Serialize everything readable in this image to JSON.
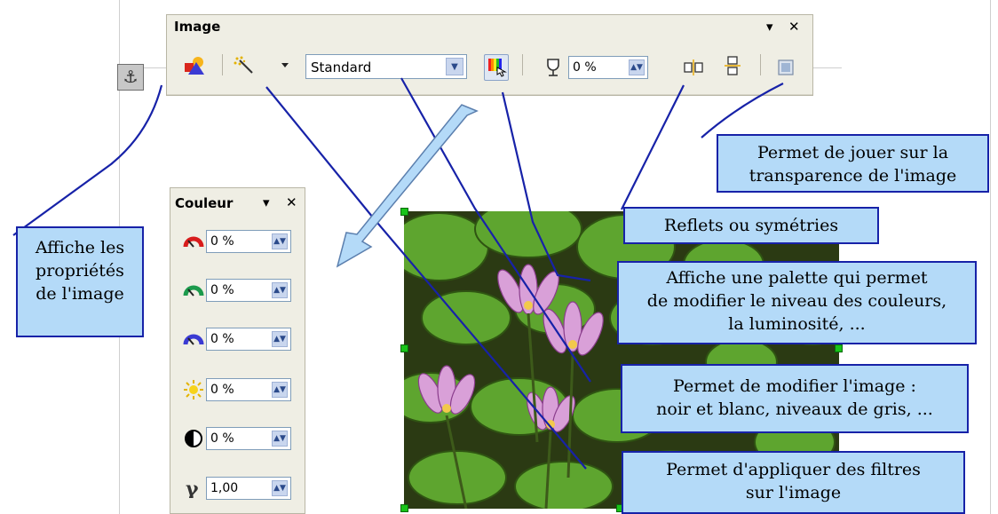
{
  "toolbar": {
    "title": "Image",
    "menu_glyph": "▾",
    "close_glyph": "✕",
    "filter_mode": "Standard",
    "transparency": "0 %",
    "icons": [
      "graphic-properties-icon",
      "filter-magic-wand-icon",
      "dropdown-arrow-icon",
      "color-palette-icon",
      "transparency-glass-icon",
      "flip-vertical-icon",
      "flip-horizontal-icon",
      "frame-properties-icon"
    ]
  },
  "couleur_panel": {
    "title": "Couleur",
    "menu_glyph": "▾",
    "close_glyph": "✕",
    "rows": [
      {
        "icon": "red-gauge-icon",
        "value": "0 %"
      },
      {
        "icon": "green-gauge-icon",
        "value": "0 %"
      },
      {
        "icon": "blue-gauge-icon",
        "value": "0 %"
      },
      {
        "icon": "brightness-sun-icon",
        "value": "0 %"
      },
      {
        "icon": "contrast-icon",
        "value": "0 %"
      },
      {
        "icon": "gamma-icon",
        "value": "1,00"
      }
    ]
  },
  "callouts": {
    "properties": [
      "Affiche les",
      "propriétés",
      "de l'image"
    ],
    "transparency": [
      "Permet de jouer sur la",
      "transparence de l'image"
    ],
    "flip": [
      "Reflets ou symétries"
    ],
    "palette": [
      "Affiche une palette qui permet",
      "de modifier le niveau des couleurs,",
      "la luminosité, ..."
    ],
    "mode": [
      "Permet de modifier l'image :",
      "noir et blanc, niveaux de gris, ..."
    ],
    "filters": [
      "Permet d'appliquer des filtres",
      "sur l'image"
    ]
  },
  "colors": {
    "callout_fill": "#b4daf8",
    "callout_border": "#1722a8",
    "pointer_line": "#1722a8",
    "toolbar_bg": "#efeee4",
    "handle": "#19c319"
  }
}
